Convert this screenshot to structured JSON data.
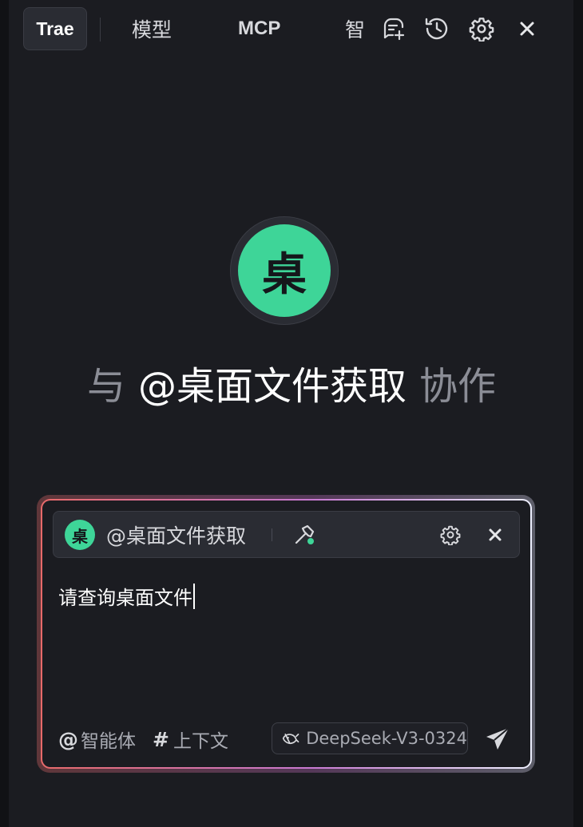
{
  "tabs": {
    "trae": "Trae",
    "model": "模型",
    "mcp": "MCP",
    "agent": "智"
  },
  "header_icons": [
    "new-chat-icon",
    "history-icon",
    "gear-icon",
    "close-icon"
  ],
  "hero": {
    "avatar_char": "桌",
    "prefix": "与",
    "agent_name": "@桌面文件获取",
    "suffix": "协作"
  },
  "composer": {
    "chip": {
      "avatar_char": "桌",
      "agent_name": "@桌面文件获取",
      "tool_icon": "hammer-icon"
    },
    "input_value": "请查询桌面文件",
    "agent_link": {
      "symbol": "@",
      "label": "智能体"
    },
    "context_link": {
      "symbol": "#",
      "label": "上下文"
    },
    "model": "DeepSeek-V3-0324"
  },
  "colors": {
    "background": "#1b1c21",
    "accent_green": "#3ed598",
    "border_gradient_start": "#e86a6a",
    "border_gradient_end": "#eef0ff"
  }
}
